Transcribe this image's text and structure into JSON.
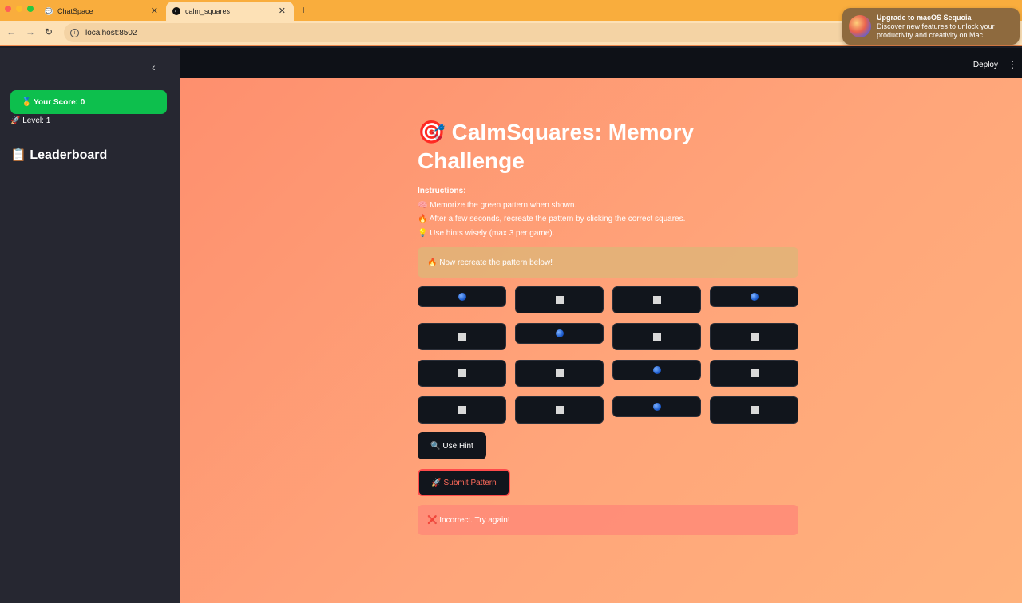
{
  "browser": {
    "tabs": [
      {
        "label": "ChatSpace",
        "icon": "chat-bubble-icon"
      },
      {
        "label": "calm_squares",
        "icon": "streamlit-logo-icon"
      }
    ],
    "url": "localhost:8502"
  },
  "notification": {
    "title": "Upgrade to macOS Sequoia",
    "body": "Discover new features to unlock your productivity and creativity on Mac."
  },
  "sidebar": {
    "score": "🥇 Your Score: 0",
    "level": "🚀 Level: 1",
    "leaderboard": "📋 Leaderboard"
  },
  "header": {
    "deploy": "Deploy"
  },
  "main": {
    "title": "🎯 CalmSquares: Memory Challenge",
    "instructions_head": "Instructions:",
    "instructions": [
      "🧠 Memorize the green pattern when shown.",
      "🔥 After a few seconds, recreate the pattern by clicking the correct squares.",
      "💡 Use hints wisely (max 3 per game)."
    ],
    "info_alert": "🔥 Now recreate the pattern below!",
    "grid": [
      [
        "ball",
        "box",
        "box",
        "ball"
      ],
      [
        "box",
        "ball",
        "box",
        "box"
      ],
      [
        "box",
        "box",
        "ball",
        "box"
      ],
      [
        "box",
        "box",
        "ball",
        "box"
      ]
    ],
    "hint_button": "🔍 Use Hint",
    "submit_button": "🚀 Submit Pattern",
    "error_alert": "❌ Incorrect. Try again!"
  },
  "colors": {
    "sidebar_bg": "#262731",
    "score_green": "#0dbf4d",
    "square_bg": "#11151c",
    "submit_border": "#ff4b4b",
    "tab_bar": "#f9ad3d"
  }
}
